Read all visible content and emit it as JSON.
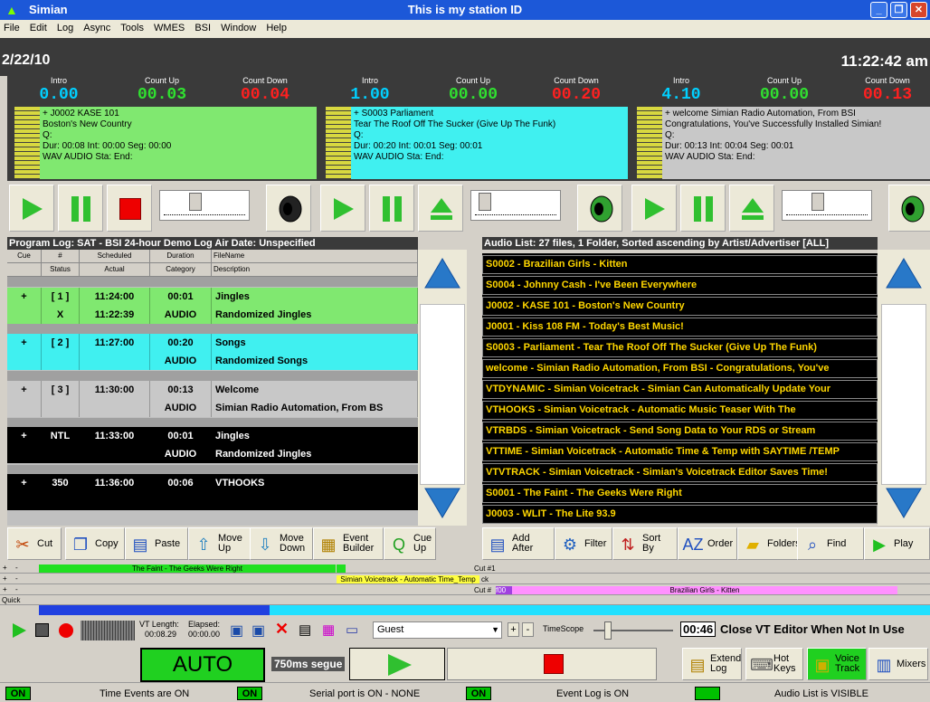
{
  "window": {
    "app_name": "Simian",
    "station_id": "This is my station ID"
  },
  "menu": [
    "File",
    "Edit",
    "Log",
    "Async",
    "Tools",
    "WMES",
    "BSI",
    "Window",
    "Help"
  ],
  "datebar": {
    "date": "2/22/10",
    "clock": "11:22:42 am"
  },
  "counter_labels": {
    "intro": "Intro",
    "up": "Count Up",
    "down": "Count Down"
  },
  "decks": [
    {
      "intro": "0.00",
      "count_up": "00.03",
      "count_down": "00.04",
      "color": "#80e870",
      "lines": [
        "+ J0002 KASE 101",
        "Boston's New Country",
        "Q:",
        "Dur: 00:08  Int: 00:00    Seg: 00:00",
        "WAV  AUDIO   Sta:                     End:"
      ]
    },
    {
      "intro": "1.00",
      "count_up": "00.00",
      "count_down": "00.20",
      "color": "#40f0f0",
      "lines": [
        "+ S0003  Parliament",
        "Tear The Roof Off The Sucker (Give Up The Funk)",
        "Q:",
        "Dur: 00:20  Int: 00:01    Seg: 00:01",
        "WAV  AUDIO   Sta:                     End:"
      ]
    },
    {
      "intro": "4.10",
      "count_up": "00.00",
      "count_down": "00.13",
      "color": "#c8c8c8",
      "lines": [
        "+ welcome  Simian Radio Automation, From BSI",
        "Congratulations, You've Successfully Installed Simian!",
        "Q:",
        "Dur: 00:13  Int: 00:04    Seg: 00:01",
        "WAV  AUDIO   Sta:                     End:"
      ]
    }
  ],
  "program_log": {
    "header": "Program Log: SAT - BSI 24-hour Demo Log   Air Date: Unspecified",
    "cols_top": [
      "Cue",
      "#",
      "Scheduled",
      "Duration",
      "FileName"
    ],
    "cols_bottom": [
      "",
      "Status",
      "Actual",
      "Category",
      "Description"
    ],
    "rows": [
      {
        "cue": "+",
        "num": "[ 1 ]",
        "sched": "11:24:00",
        "dur": "00:01",
        "file": "Jingles",
        "status": "X",
        "actual": "11:22:39",
        "cat": "AUDIO",
        "desc": "Randomized Jingles",
        "bg": "#80e870",
        "fg": "#000"
      },
      {
        "cue": "+",
        "num": "[ 2 ]",
        "sched": "11:27:00",
        "dur": "00:20",
        "file": "Songs",
        "status": "",
        "actual": "",
        "cat": "AUDIO",
        "desc": "Randomized Songs",
        "bg": "#40f0f0",
        "fg": "#000"
      },
      {
        "cue": "+",
        "num": "[ 3 ]",
        "sched": "11:30:00",
        "dur": "00:13",
        "file": "Welcome",
        "status": "",
        "actual": "",
        "cat": "AUDIO",
        "desc": "Simian Radio Automation, From BS",
        "bg": "#c8c8c8",
        "fg": "#000"
      },
      {
        "cue": "+",
        "num": "NTL",
        "sched": "11:33:00",
        "dur": "00:01",
        "file": "Jingles",
        "status": "",
        "actual": "",
        "cat": "AUDIO",
        "desc": "Randomized Jingles",
        "bg": "#000000",
        "fg": "#ffffff"
      },
      {
        "cue": "+",
        "num": "350",
        "sched": "11:36:00",
        "dur": "00:06",
        "file": "VTHOOKS",
        "status": "",
        "actual": "",
        "cat": "",
        "desc": "",
        "bg": "#000000",
        "fg": "#ffffff"
      }
    ]
  },
  "audio_list": {
    "header": "Audio List: 27 files, 1 Folder, Sorted ascending by Artist/Advertiser [ALL]",
    "items": [
      "S0002 - Brazilian Girls - Kitten",
      "S0004 - Johnny Cash - I've Been Everywhere",
      "J0002 - KASE 101 - Boston's New Country",
      "J0001 - Kiss 108 FM - Today's Best Music!",
      "S0003 - Parliament - Tear The Roof Off The Sucker (Give Up The Funk)",
      "welcome - Simian Radio Automation, From BSI - Congratulations, You've",
      "VTDYNAMIC - Simian Voicetrack - Simian Can Automatically Update Your",
      "VTHOOKS - Simian Voicetrack - Automatic Music Teaser With The",
      "VTRBDS - Simian Voicetrack - Send Song Data to Your RDS or Stream",
      "VTTIME - Simian Voicetrack - Automatic Time & Temp with SAYTIME /TEMP",
      "VTVTRACK - Simian Voicetrack - Simian's Voicetrack Editor Saves Time!",
      "S0001 - The Faint - The Geeks Were Right",
      "J0003 - WLIT - The Lite 93.9"
    ]
  },
  "log_toolbar": [
    {
      "name": "cut",
      "l1": "Cut",
      "l2": ""
    },
    {
      "name": "copy",
      "l1": "Copy",
      "l2": ""
    },
    {
      "name": "paste",
      "l1": "Paste",
      "l2": ""
    },
    {
      "name": "move-up",
      "l1": "Move",
      "l2": "Up"
    },
    {
      "name": "move-down",
      "l1": "Move",
      "l2": "Down"
    },
    {
      "name": "event-builder",
      "l1": "Event",
      "l2": "Builder"
    },
    {
      "name": "cue-up",
      "l1": "Cue",
      "l2": "Up"
    }
  ],
  "audio_toolbar": [
    {
      "name": "add-after",
      "l1": "Add",
      "l2": "After"
    },
    {
      "name": "filter",
      "l1": "Filter",
      "l2": ""
    },
    {
      "name": "sort-by",
      "l1": "Sort",
      "l2": "By"
    },
    {
      "name": "order",
      "l1": "Order",
      "l2": ""
    },
    {
      "name": "folders",
      "l1": "Folders",
      "l2": ""
    },
    {
      "name": "find",
      "l1": "Find",
      "l2": ""
    },
    {
      "name": "play",
      "l1": "Play",
      "l2": ""
    }
  ],
  "timeline": {
    "track1_label": "The Faint - The Geeks Were Right",
    "cut1": "Cut #1",
    "vt_label": "Simian Voicetrack - Automatic Time_Temp",
    "vt_suffix": "ck",
    "cut_prefix": "Cut #",
    "cut_box": "f00",
    "track3_label": "Brazilian Girls - Kitten",
    "quick": "Quick"
  },
  "vt_editor": {
    "vt_length_label": "VT Length:",
    "elapsed_label": "Elapsed:",
    "vt_length": "00:08.29",
    "elapsed": "00:00.00",
    "user": "Guest",
    "timescope": "TimeScope",
    "time": "00:46",
    "close_text": "Close VT Editor When Not In Use"
  },
  "auto": {
    "mode": "AUTO",
    "segue": "750ms segue",
    "buttons": [
      {
        "name": "extend-log",
        "l1": "Extend",
        "l2": "Log"
      },
      {
        "name": "hot-keys",
        "l1": "Hot",
        "l2": "Keys"
      },
      {
        "name": "voice-track",
        "l1": "Voice",
        "l2": "Track"
      },
      {
        "name": "mixers",
        "l1": "Mixers",
        "l2": ""
      }
    ]
  },
  "status": [
    {
      "flag": "ON",
      "text": "Time Events are ON"
    },
    {
      "flag": "ON",
      "text": "Serial port is ON - NONE"
    },
    {
      "flag": "ON",
      "text": "Event Log is ON"
    },
    {
      "flag": "",
      "text": "Audio List is VISIBLE"
    }
  ]
}
